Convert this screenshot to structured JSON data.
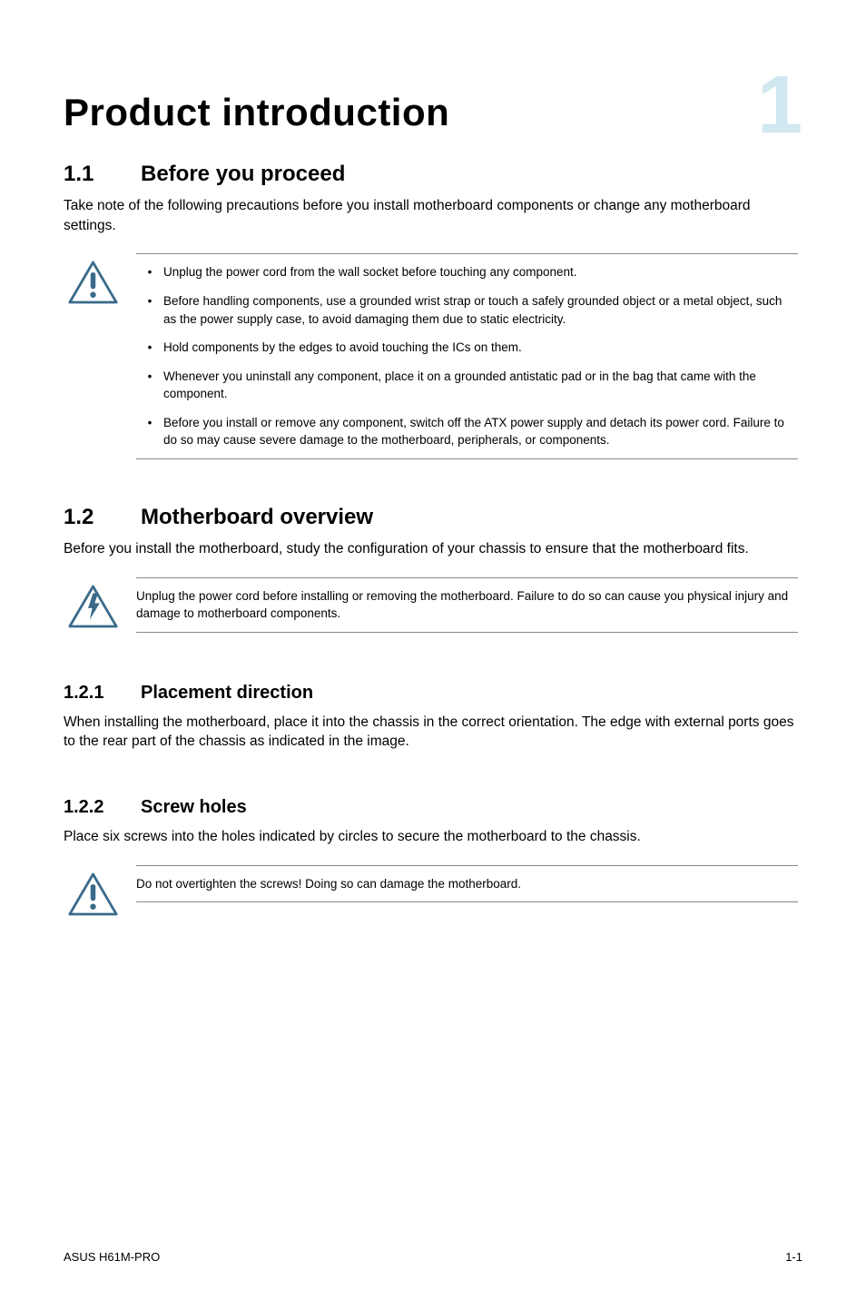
{
  "chapter": {
    "title": "Product introduction",
    "number": "1"
  },
  "section_1_1": {
    "num": "1.1",
    "title": "Before you proceed",
    "body": "Take note of the following precautions before you install motherboard components or change any motherboard settings.",
    "bullets": [
      "Unplug the power cord from the wall socket before touching any component.",
      "Before handling components, use a grounded wrist strap or touch a safely grounded object or a metal object, such as the power supply case, to avoid damaging them due to static electricity.",
      "Hold components by the edges to avoid touching the ICs on them.",
      "Whenever you uninstall any component, place it on a grounded antistatic pad or in the bag that came with the component.",
      "Before you install or remove any component, switch off the ATX power supply and detach its power cord. Failure to do so may cause severe damage to the motherboard, peripherals, or components."
    ]
  },
  "section_1_2": {
    "num": "1.2",
    "title": "Motherboard overview",
    "body": "Before you install the motherboard, study the configuration of your chassis to ensure that the motherboard fits.",
    "warning": "Unplug the power cord before installing or removing the motherboard. Failure to do so can cause you physical injury and damage to motherboard components."
  },
  "section_1_2_1": {
    "num": "1.2.1",
    "title": "Placement direction",
    "body": "When installing the motherboard, place it into the chassis in the correct orientation. The edge with external ports goes to the rear part of the chassis as indicated in the image."
  },
  "section_1_2_2": {
    "num": "1.2.2",
    "title": "Screw holes",
    "body": "Place six screws into the holes indicated by circles to secure the motherboard to the chassis.",
    "caution": "Do not overtighten the screws! Doing so can damage the motherboard."
  },
  "footer": {
    "product": "ASUS H61M-PRO",
    "page": "1-1"
  }
}
